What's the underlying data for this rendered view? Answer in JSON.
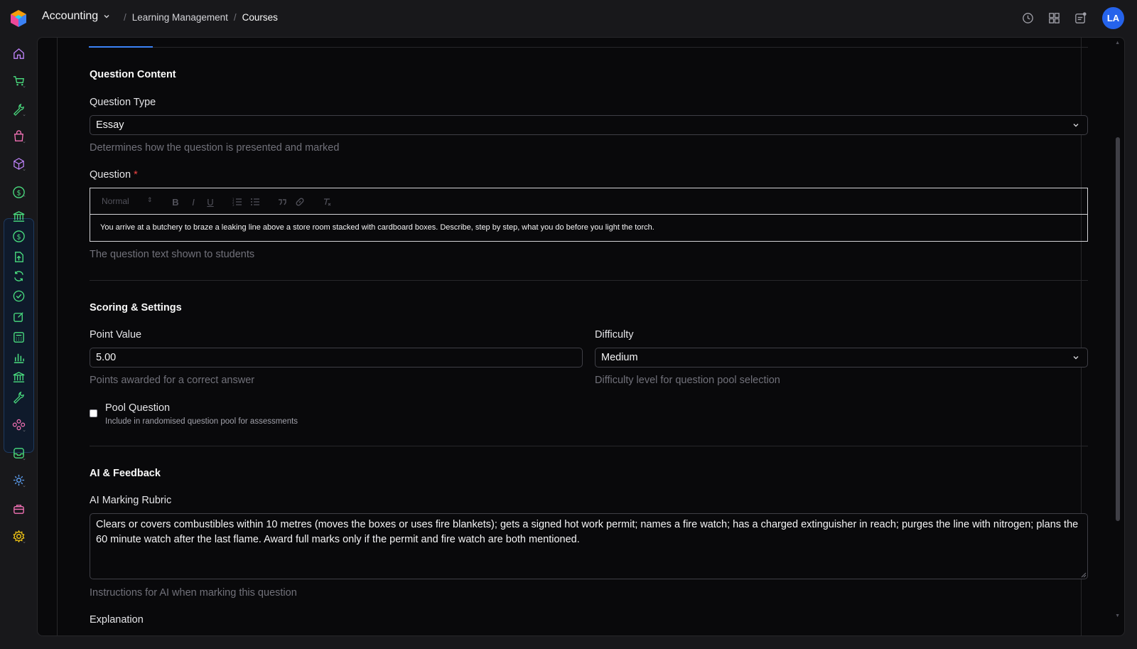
{
  "header": {
    "app_name": "Accounting",
    "breadcrumbs": [
      "Learning Management",
      "Courses"
    ],
    "avatar_initials": "LA"
  },
  "sidebar": {
    "items": [
      "home-icon",
      "cart-icon",
      "wrench-icon",
      "bag-icon",
      "cube-icon",
      "dollar-icon",
      "bank-icon",
      "dollar-icon",
      "upload-icon",
      "refresh-icon",
      "check-icon",
      "edit-icon",
      "calculator-icon",
      "chart-icon",
      "bank-icon",
      "wrench-icon",
      "network-icon",
      "inbox-icon",
      "cog-network-icon",
      "briefcase-icon",
      "gear-icon"
    ],
    "accent_color": "#22c55e",
    "home_color": "#a855f7"
  },
  "form": {
    "question_content": {
      "title": "Question Content",
      "question_type_label": "Question Type",
      "question_type_value": "Essay",
      "question_type_help": "Determines how the question is presented and marked",
      "question_label": "Question",
      "required_mark": "*",
      "editor_format": "Normal",
      "question_text": "You arrive at a butchery to braze a leaking line above a store room stacked with cardboard boxes. Describe, step by step, what you do before you light the torch.",
      "question_help": "The question text shown to students"
    },
    "scoring": {
      "title": "Scoring & Settings",
      "point_value_label": "Point Value",
      "point_value": "5.00",
      "point_value_help": "Points awarded for a correct answer",
      "difficulty_label": "Difficulty",
      "difficulty_value": "Medium",
      "difficulty_help": "Difficulty level for question pool selection",
      "pool_label": "Pool Question",
      "pool_desc": "Include in randomised question pool for assessments"
    },
    "ai": {
      "title": "AI & Feedback",
      "rubric_label": "AI Marking Rubric",
      "rubric_value": "Clears or covers combustibles within 10 metres (moves the boxes or uses fire blankets); gets a signed hot work permit; names a fire watch; has a charged extinguisher in reach; purges the line with nitrogen; plans the 60 minute watch after the last flame. Award full marks only if the permit and fire watch are both mentioned.",
      "rubric_help": "Instructions for AI when marking this question",
      "explanation_label": "Explanation"
    }
  }
}
